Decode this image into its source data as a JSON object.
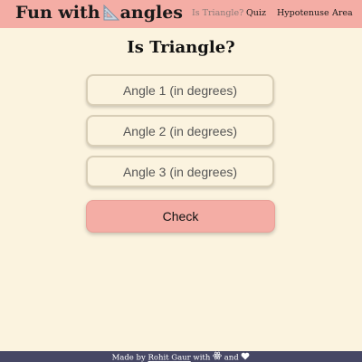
{
  "navbar": {
    "brand_prefix": "Fun with",
    "brand_icon": "set-square-ruler-icon",
    "brand_suffix": "angles",
    "links": [
      {
        "label": "Is Triangle?",
        "active": true
      },
      {
        "label": "Quiz",
        "active": false
      },
      {
        "label": "Hypotenuse",
        "active": false
      },
      {
        "label": "Area",
        "active": false
      }
    ]
  },
  "main": {
    "title": "Is Triangle?",
    "inputs": [
      {
        "placeholder": "Angle 1 (in degrees)",
        "value": ""
      },
      {
        "placeholder": "Angle 2 (in degrees)",
        "value": ""
      },
      {
        "placeholder": "Angle 3 (in degrees)",
        "value": ""
      }
    ],
    "check_label": "Check"
  },
  "footer": {
    "made_by": "Made by",
    "author": "Rohit Gaur",
    "with": "with",
    "react_icon": "react-atom-icon",
    "and": "and",
    "heart_icon": "heart-icon"
  },
  "colors": {
    "background": "#fbf3df",
    "navbar": "#f4ada5",
    "button": "#f4ada5",
    "footer": "#464764"
  }
}
